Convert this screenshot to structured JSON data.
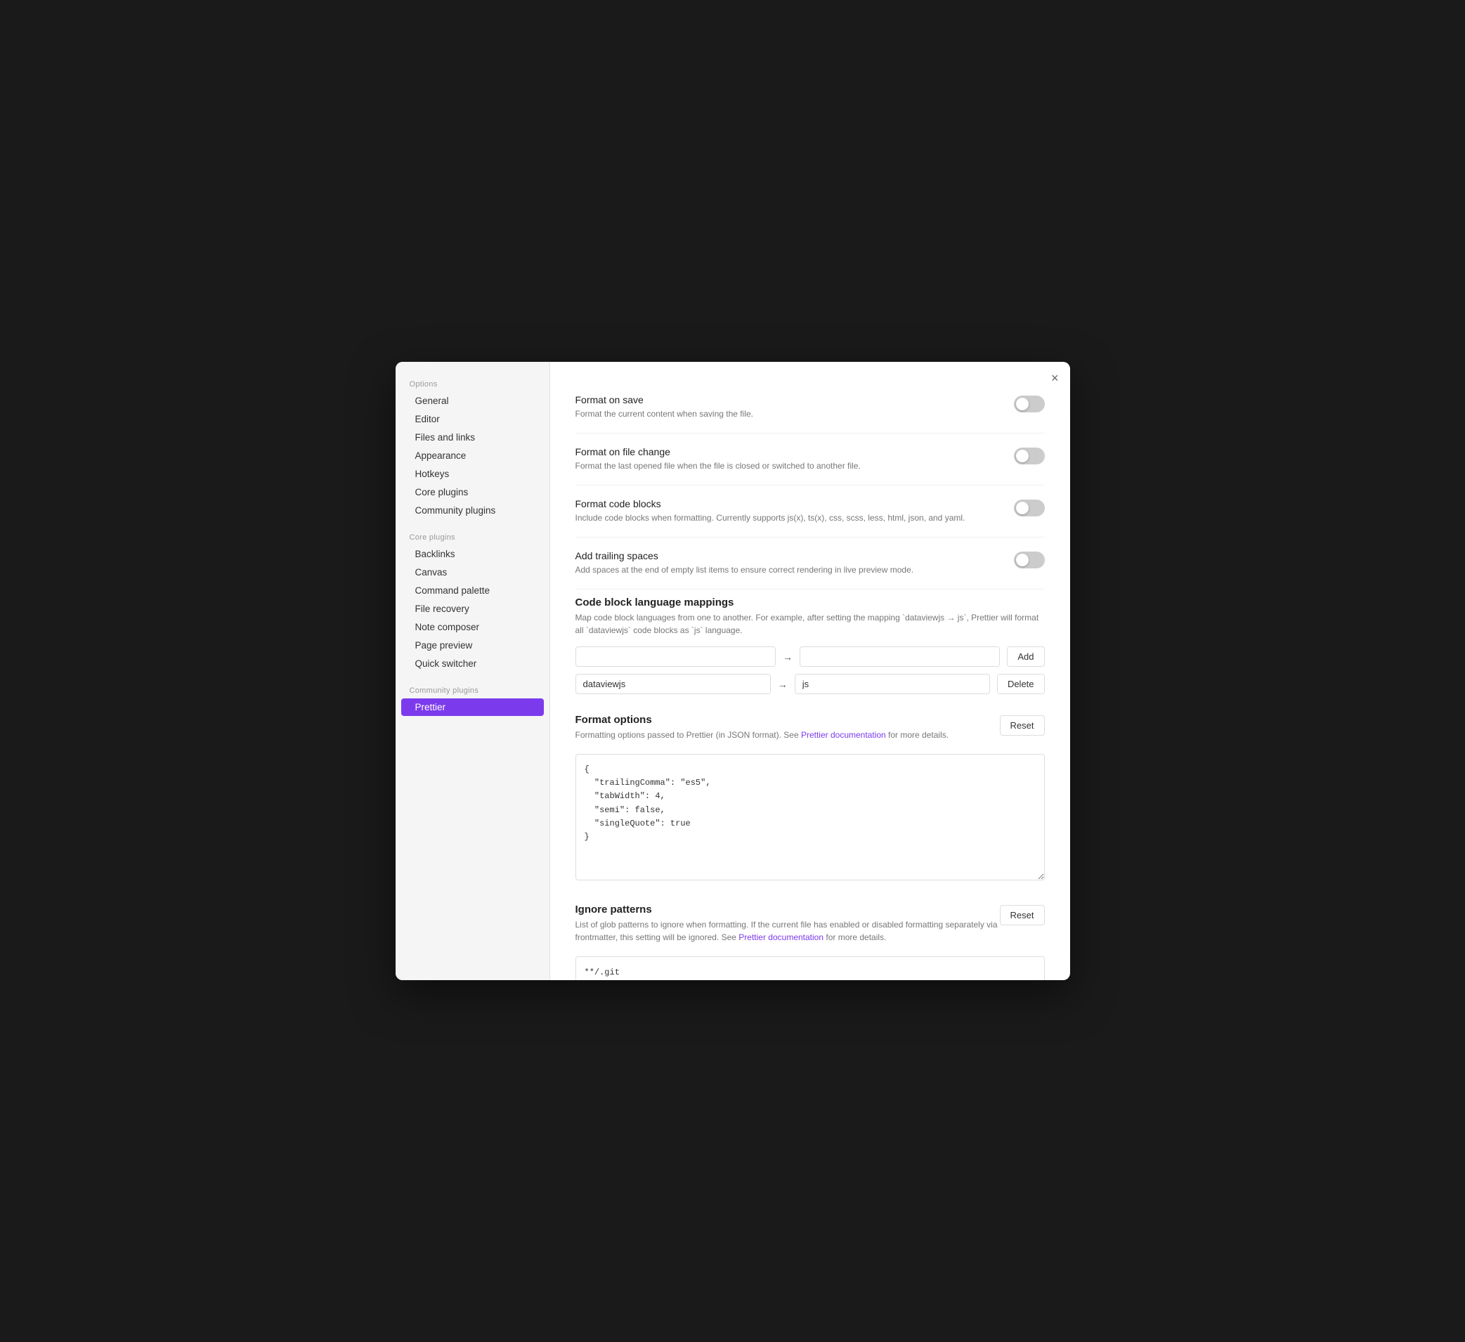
{
  "modal": {
    "close_label": "×"
  },
  "sidebar": {
    "options_label": "Options",
    "core_plugins_label": "Core plugins",
    "community_plugins_label": "Community plugins",
    "options_items": [
      {
        "id": "general",
        "label": "General"
      },
      {
        "id": "editor",
        "label": "Editor"
      },
      {
        "id": "files-and-links",
        "label": "Files and links"
      },
      {
        "id": "appearance",
        "label": "Appearance"
      },
      {
        "id": "hotkeys",
        "label": "Hotkeys"
      },
      {
        "id": "core-plugins",
        "label": "Core plugins"
      },
      {
        "id": "community-plugins",
        "label": "Community plugins"
      }
    ],
    "core_plugin_items": [
      {
        "id": "backlinks",
        "label": "Backlinks"
      },
      {
        "id": "canvas",
        "label": "Canvas"
      },
      {
        "id": "command-palette",
        "label": "Command palette"
      },
      {
        "id": "file-recovery",
        "label": "File recovery"
      },
      {
        "id": "note-composer",
        "label": "Note composer"
      },
      {
        "id": "page-preview",
        "label": "Page preview"
      },
      {
        "id": "quick-switcher",
        "label": "Quick switcher"
      }
    ],
    "community_plugin_items": [
      {
        "id": "prettier",
        "label": "Prettier",
        "active": true
      }
    ]
  },
  "settings": {
    "format_on_save": {
      "title": "Format on save",
      "desc": "Format the current content when saving the file."
    },
    "format_on_file_change": {
      "title": "Format on file change",
      "desc": "Format the last opened file when the file is closed or switched to another file."
    },
    "format_code_blocks": {
      "title": "Format code blocks",
      "desc": "Include code blocks when formatting. Currently supports js(x), ts(x), css, scss, less, html, json, and yaml."
    },
    "add_trailing_spaces": {
      "title": "Add trailing spaces",
      "desc": "Add spaces at the end of empty list items to ensure correct rendering in live preview mode."
    },
    "code_block_language_mappings": {
      "title": "Code block language mappings",
      "desc": "Map code block languages from one to another. For example, after setting the mapping `dataviewjs → js`, Prettier will format all `dataviewjs` code blocks as `js` language.",
      "from_placeholder": "",
      "to_placeholder": "",
      "add_button": "Add",
      "mapping_from": "dataviewjs",
      "mapping_to": "js",
      "delete_button": "Delete",
      "arrow": "→"
    },
    "format_options": {
      "title": "Format options",
      "desc_prefix": "Formatting options passed to Prettier (in JSON format). See ",
      "link_text": "Prettier documentation",
      "desc_suffix": " for more details.",
      "reset_button": "Reset",
      "code_value": "{\n  \"trailingComma\": \"es5\",\n  \"tabWidth\": 4,\n  \"semi\": false,\n  \"singleQuote\": true\n}"
    },
    "ignore_patterns": {
      "title": "Ignore patterns",
      "desc_prefix": "List of glob patterns to ignore when formatting. If the current file has enabled or disabled formatting separately via frontmatter, this setting will be ignored. See ",
      "link_text": "Prettier documentation",
      "desc_suffix": " for more details.",
      "reset_button": "Reset",
      "patterns_value": "**/.git\n**/.svn\n**/.hg\n**/node_modules"
    }
  }
}
